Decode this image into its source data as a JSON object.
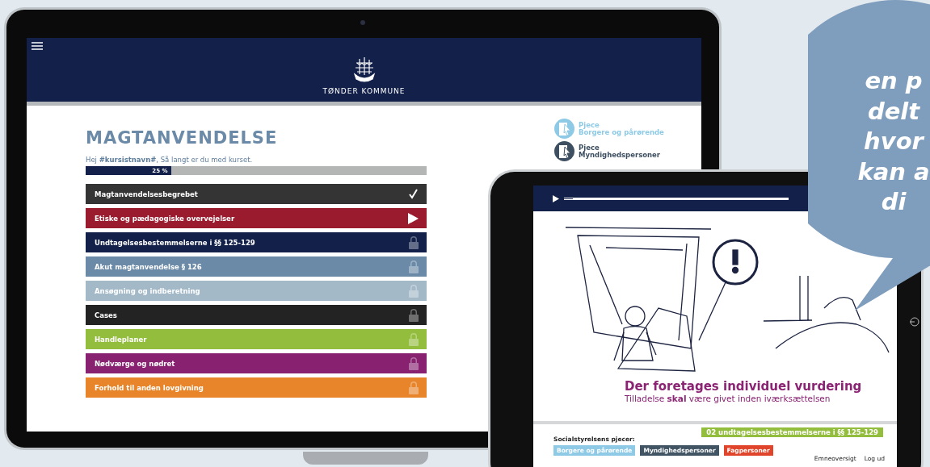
{
  "laptop": {
    "brand": "TØNDER KOMMUNE",
    "title": "MAGTANVENDELSE",
    "greeting": "Hej **#kursistnavn#**, Så langt er du med kurset.",
    "progress": {
      "level": 0.25,
      "label": "25 %"
    },
    "modules": [
      {
        "label": "Magtanvendelsesbegrebet",
        "color": "#343434",
        "kind": "done"
      },
      {
        "label": "Etiske og pædagogiske overvejelser",
        "color": "#9a1b2e",
        "kind": "current"
      },
      {
        "label": "Undtagelsesbestemmelserne i §§ 125-129",
        "color": "#13214a",
        "kind": "locked"
      },
      {
        "label": "Akut magtanvendelse § 126",
        "color": "#6a8aa8",
        "kind": "locked"
      },
      {
        "label": "Ansøgning og indberetning",
        "color": "#a3b9c8",
        "kind": "locked"
      },
      {
        "label": "Cases",
        "color": "#232323",
        "kind": "locked"
      },
      {
        "label": "Handleplaner",
        "color": "#93bd3c",
        "kind": "locked"
      },
      {
        "label": "Nødværge og nødret",
        "color": "#872170",
        "kind": "locked"
      },
      {
        "label": "Forhold til anden lovgivning",
        "color": "#e8852a",
        "kind": "locked"
      }
    ],
    "pjecer": [
      {
        "title": "Pjece",
        "subtitle": "Borgere og pårørende",
        "color": "#8ecae6"
      },
      {
        "title": "Pjece",
        "subtitle": "Myndighedspersoner",
        "color": "#3d4f60"
      }
    ]
  },
  "tablet": {
    "player": {
      "level": 0.04
    },
    "caption_title": "Der foretages individuel vurdering",
    "caption_sub": "Tilladelse **skal** være givet inden iværksættelsen",
    "chapter": "02 undtagelsesbestemmelserne i §§ 125-129",
    "pjecer_label": "Socialstyrelsens pjecer:",
    "pjecer": [
      {
        "label": "Borgere og pårørende",
        "color": "#8ecae6"
      },
      {
        "label": "Myndighedspersoner",
        "color": "#415464"
      },
      {
        "label": "Fagpersoner",
        "color": "#e0452b"
      }
    ],
    "links": [
      "Emneoversigt",
      "Log ud"
    ]
  },
  "bubble": {
    "lines": [
      "en p",
      "delt",
      "hvor",
      "kan a",
      "di"
    ]
  }
}
